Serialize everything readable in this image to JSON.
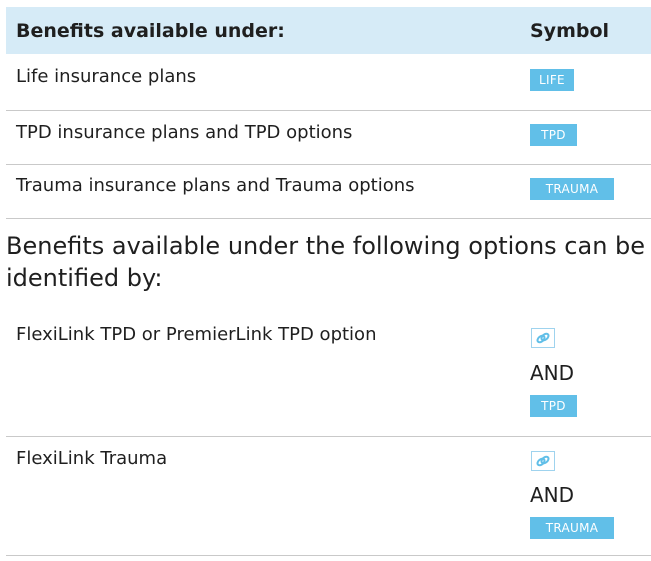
{
  "table1": {
    "header_label": "Benefits available under:",
    "header_symbol": "Symbol",
    "rows": [
      {
        "label": "Life insurance plans",
        "symbol": "LIFE"
      },
      {
        "label": "TPD insurance plans and TPD options",
        "symbol": "TPD"
      },
      {
        "label": "Trauma insurance plans and Trauma options",
        "symbol": "TRAUMA"
      }
    ]
  },
  "paragraph": "Benefits available under the following options can be identified by:",
  "table2": {
    "rows": [
      {
        "label": "FlexiLink TPD or PremierLink TPD option",
        "icon": "link-icon",
        "connector": "AND",
        "symbol": "TPD"
      },
      {
        "label": "FlexiLink Trauma",
        "icon": "link-icon",
        "connector": "AND",
        "symbol": "TRAUMA"
      }
    ]
  },
  "colors": {
    "header_bg": "#d6ebf7",
    "badge_bg": "#61bfe8",
    "divider": "#c9c9c9"
  }
}
